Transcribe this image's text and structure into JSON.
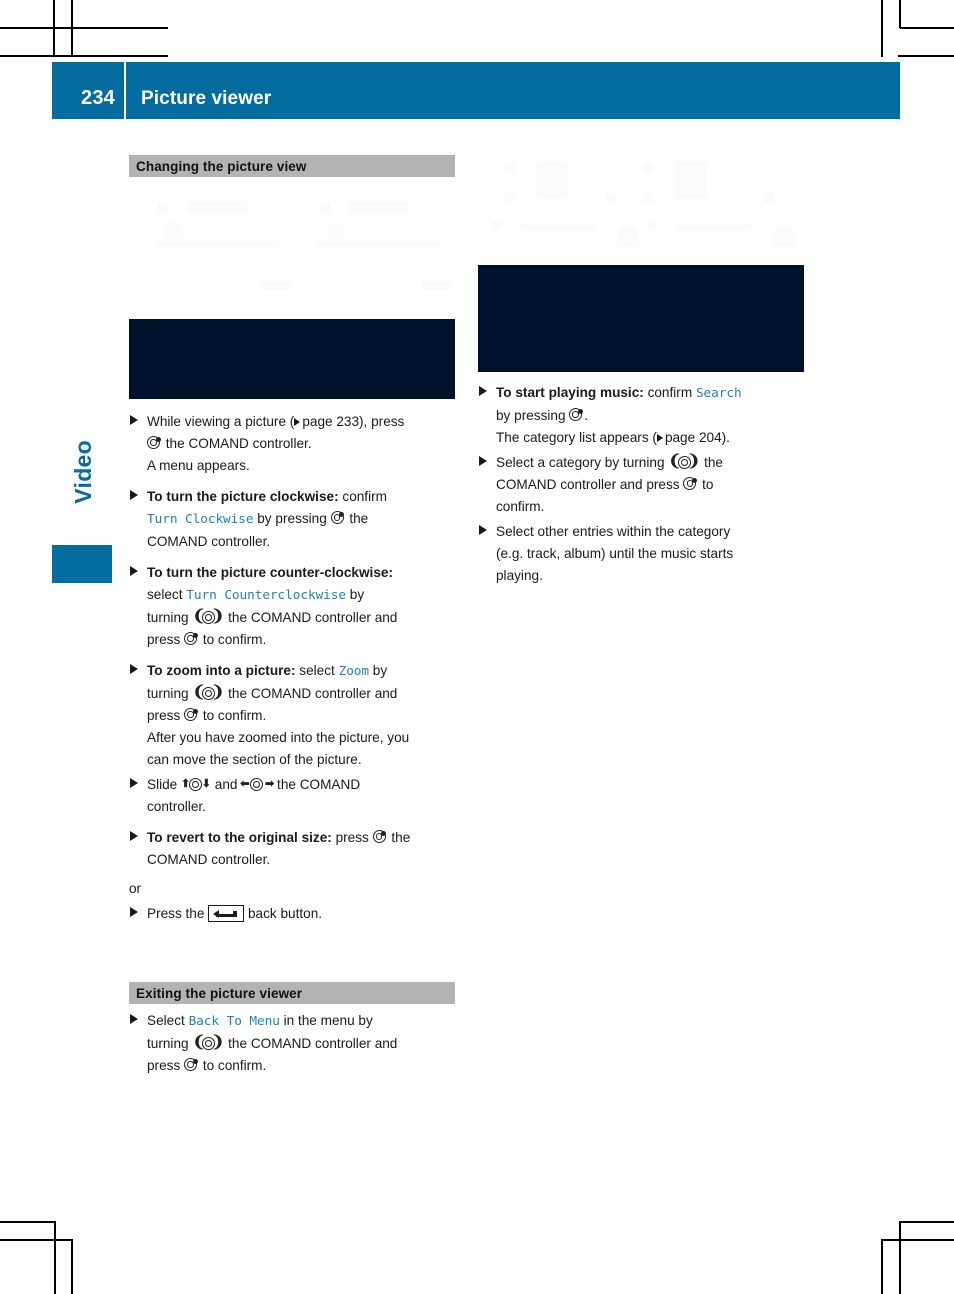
{
  "header": {
    "page_number": "234",
    "title": "Picture viewer",
    "accent_color": "#046c9e"
  },
  "chapter_tab": {
    "label": "Video",
    "color": "#046c9e"
  },
  "colors": {
    "accent": "#046c9e",
    "section_bar": "#b3b3b3",
    "command_text": "#2181b8",
    "figure_fill": "#00112b"
  },
  "left_column": {
    "section_heading": "Changing the picture view",
    "steps": [
      {
        "id": "while-viewing",
        "line1_a": "While viewing a picture (",
        "ref": "page 233",
        "line1_b": "), press",
        "line2": "the COMAND controller.",
        "line3": "A menu appears."
      },
      {
        "id": "turn-clockwise",
        "lead": "To turn the picture clockwise:",
        "after_lead": "confirm",
        "command": "Turn Clockwise",
        "mid": "by pressing",
        "tail": "the",
        "line3": "COMAND controller."
      },
      {
        "id": "turn-counterclockwise",
        "lead": "To turn the picture counter-clockwise:",
        "line2_a": "select",
        "command": "Turn Counterclockwise",
        "line2_b": "by",
        "line3_a": "turning",
        "line3_b": "the COMAND controller and",
        "line4_a": "press",
        "line4_b": "to confirm."
      },
      {
        "id": "zoom-into-picture",
        "lead": "To zoom into a picture:",
        "after_lead": "select",
        "command": "Zoom",
        "after_command": "by",
        "line2_a": "turning",
        "line2_b": "the COMAND controller and",
        "line3_a": "press",
        "line3_b": "to confirm.",
        "note1": "After you have zoomed into the picture, you",
        "note2": "can move the section of the picture."
      },
      {
        "id": "slide-controller",
        "line1_a": "Slide",
        "line1_b": "and",
        "line1_c": "the COMAND",
        "line2": "controller."
      },
      {
        "id": "revert-original-size",
        "lead": "To revert to the original size:",
        "after_lead": "press",
        "tail": "the",
        "line2": "COMAND controller."
      }
    ],
    "or_label": "or",
    "back_step": {
      "id": "press-back-button",
      "before": "Press the",
      "after": "back button."
    },
    "exit_section": {
      "heading": "Exiting the picture viewer",
      "step": {
        "id": "back-to-menu",
        "line1_a": "Select",
        "command": "Back To Menu",
        "line1_b": "in the menu by",
        "line2_a": "turning",
        "line2_b": "the COMAND controller and",
        "line3_a": "press",
        "line3_b": "to confirm."
      }
    }
  },
  "right_column": {
    "steps": [
      {
        "id": "start-playing-music",
        "lead": "To start playing music:",
        "after_lead": "confirm",
        "command": "Search",
        "line2_a": "by pressing",
        "line2_b": ".",
        "line3_a": "The category list appears (",
        "ref": "page 204",
        "line3_b": ")."
      },
      {
        "id": "select-category",
        "line1_a": "Select a category by turning",
        "line1_b": "the",
        "line2_a": "COMAND controller and press",
        "line2_b": "to",
        "line3": "confirm."
      },
      {
        "id": "select-other-entries",
        "line1": "Select other entries within the category",
        "line2": "(e.g. track, album) until the music starts",
        "line3": "playing."
      }
    ]
  },
  "icons": {
    "press_controller": "comand-press-icon",
    "turn_controller": "comand-turn-icon",
    "slide_vertical": "comand-slide-vertical-icon",
    "slide_horizontal": "comand-slide-horizontal-icon",
    "back_button": "back-button-icon",
    "page_reference": "page-reference-triangle-icon",
    "bullet": "step-bullet-icon"
  }
}
